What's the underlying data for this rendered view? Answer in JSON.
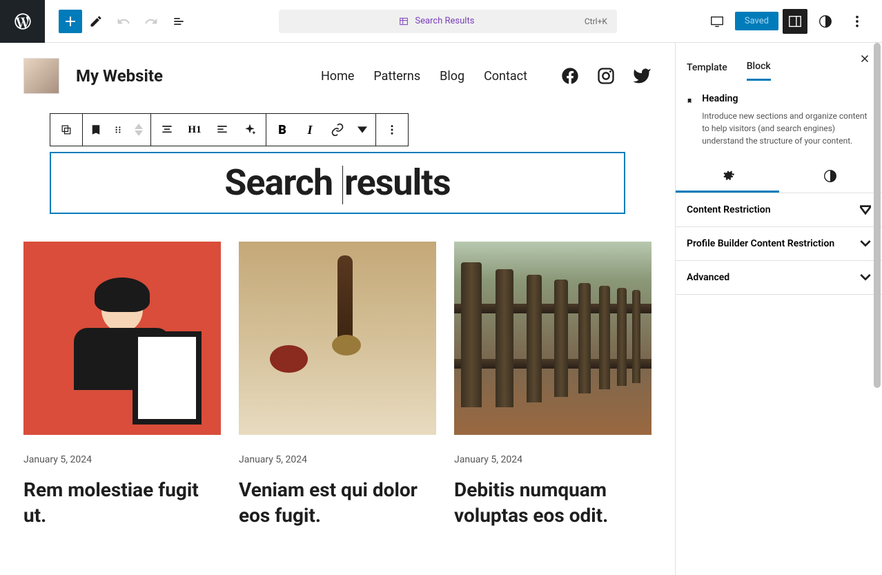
{
  "topbar": {
    "search_label": "Search Results",
    "search_shortcut": "Ctrl+K",
    "saved_label": "Saved"
  },
  "site": {
    "title": "My Website",
    "nav": [
      "Home",
      "Patterns",
      "Blog",
      "Contact"
    ]
  },
  "toolbar": {
    "heading_level": "H1"
  },
  "heading": {
    "text_before": "Search ",
    "text_after": "results"
  },
  "posts": [
    {
      "date": "January 5, 2024",
      "title": "Rem molestiae fugit ut."
    },
    {
      "date": "January 5, 2024",
      "title": "Veniam est qui dolor eos fugit."
    },
    {
      "date": "January 5, 2024",
      "title": "Debitis numquam voluptas eos odit."
    }
  ],
  "sidebar": {
    "tabs": {
      "template": "Template",
      "block": "Block"
    },
    "block_type": "Heading",
    "block_desc": "Introduce new sections and organize content to help visitors (and search engines) understand the structure of your content.",
    "panels": {
      "content_restriction": "Content Restriction",
      "profile_builder": "Profile Builder Content Restriction",
      "advanced": "Advanced"
    }
  }
}
